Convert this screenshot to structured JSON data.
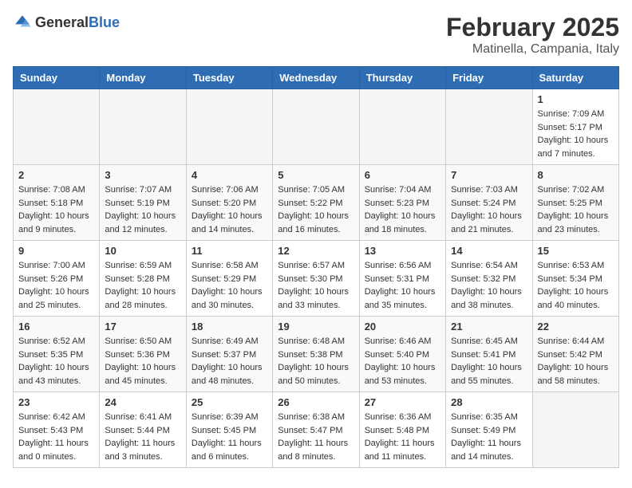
{
  "logo": {
    "general": "General",
    "blue": "Blue"
  },
  "title": {
    "month_year": "February 2025",
    "location": "Matinella, Campania, Italy"
  },
  "headers": [
    "Sunday",
    "Monday",
    "Tuesday",
    "Wednesday",
    "Thursday",
    "Friday",
    "Saturday"
  ],
  "weeks": [
    [
      {
        "day": "",
        "info": ""
      },
      {
        "day": "",
        "info": ""
      },
      {
        "day": "",
        "info": ""
      },
      {
        "day": "",
        "info": ""
      },
      {
        "day": "",
        "info": ""
      },
      {
        "day": "",
        "info": ""
      },
      {
        "day": "1",
        "info": "Sunrise: 7:09 AM\nSunset: 5:17 PM\nDaylight: 10 hours and 7 minutes."
      }
    ],
    [
      {
        "day": "2",
        "info": "Sunrise: 7:08 AM\nSunset: 5:18 PM\nDaylight: 10 hours and 9 minutes."
      },
      {
        "day": "3",
        "info": "Sunrise: 7:07 AM\nSunset: 5:19 PM\nDaylight: 10 hours and 12 minutes."
      },
      {
        "day": "4",
        "info": "Sunrise: 7:06 AM\nSunset: 5:20 PM\nDaylight: 10 hours and 14 minutes."
      },
      {
        "day": "5",
        "info": "Sunrise: 7:05 AM\nSunset: 5:22 PM\nDaylight: 10 hours and 16 minutes."
      },
      {
        "day": "6",
        "info": "Sunrise: 7:04 AM\nSunset: 5:23 PM\nDaylight: 10 hours and 18 minutes."
      },
      {
        "day": "7",
        "info": "Sunrise: 7:03 AM\nSunset: 5:24 PM\nDaylight: 10 hours and 21 minutes."
      },
      {
        "day": "8",
        "info": "Sunrise: 7:02 AM\nSunset: 5:25 PM\nDaylight: 10 hours and 23 minutes."
      }
    ],
    [
      {
        "day": "9",
        "info": "Sunrise: 7:00 AM\nSunset: 5:26 PM\nDaylight: 10 hours and 25 minutes."
      },
      {
        "day": "10",
        "info": "Sunrise: 6:59 AM\nSunset: 5:28 PM\nDaylight: 10 hours and 28 minutes."
      },
      {
        "day": "11",
        "info": "Sunrise: 6:58 AM\nSunset: 5:29 PM\nDaylight: 10 hours and 30 minutes."
      },
      {
        "day": "12",
        "info": "Sunrise: 6:57 AM\nSunset: 5:30 PM\nDaylight: 10 hours and 33 minutes."
      },
      {
        "day": "13",
        "info": "Sunrise: 6:56 AM\nSunset: 5:31 PM\nDaylight: 10 hours and 35 minutes."
      },
      {
        "day": "14",
        "info": "Sunrise: 6:54 AM\nSunset: 5:32 PM\nDaylight: 10 hours and 38 minutes."
      },
      {
        "day": "15",
        "info": "Sunrise: 6:53 AM\nSunset: 5:34 PM\nDaylight: 10 hours and 40 minutes."
      }
    ],
    [
      {
        "day": "16",
        "info": "Sunrise: 6:52 AM\nSunset: 5:35 PM\nDaylight: 10 hours and 43 minutes."
      },
      {
        "day": "17",
        "info": "Sunrise: 6:50 AM\nSunset: 5:36 PM\nDaylight: 10 hours and 45 minutes."
      },
      {
        "day": "18",
        "info": "Sunrise: 6:49 AM\nSunset: 5:37 PM\nDaylight: 10 hours and 48 minutes."
      },
      {
        "day": "19",
        "info": "Sunrise: 6:48 AM\nSunset: 5:38 PM\nDaylight: 10 hours and 50 minutes."
      },
      {
        "day": "20",
        "info": "Sunrise: 6:46 AM\nSunset: 5:40 PM\nDaylight: 10 hours and 53 minutes."
      },
      {
        "day": "21",
        "info": "Sunrise: 6:45 AM\nSunset: 5:41 PM\nDaylight: 10 hours and 55 minutes."
      },
      {
        "day": "22",
        "info": "Sunrise: 6:44 AM\nSunset: 5:42 PM\nDaylight: 10 hours and 58 minutes."
      }
    ],
    [
      {
        "day": "23",
        "info": "Sunrise: 6:42 AM\nSunset: 5:43 PM\nDaylight: 11 hours and 0 minutes."
      },
      {
        "day": "24",
        "info": "Sunrise: 6:41 AM\nSunset: 5:44 PM\nDaylight: 11 hours and 3 minutes."
      },
      {
        "day": "25",
        "info": "Sunrise: 6:39 AM\nSunset: 5:45 PM\nDaylight: 11 hours and 6 minutes."
      },
      {
        "day": "26",
        "info": "Sunrise: 6:38 AM\nSunset: 5:47 PM\nDaylight: 11 hours and 8 minutes."
      },
      {
        "day": "27",
        "info": "Sunrise: 6:36 AM\nSunset: 5:48 PM\nDaylight: 11 hours and 11 minutes."
      },
      {
        "day": "28",
        "info": "Sunrise: 6:35 AM\nSunset: 5:49 PM\nDaylight: 11 hours and 14 minutes."
      },
      {
        "day": "",
        "info": ""
      }
    ]
  ]
}
